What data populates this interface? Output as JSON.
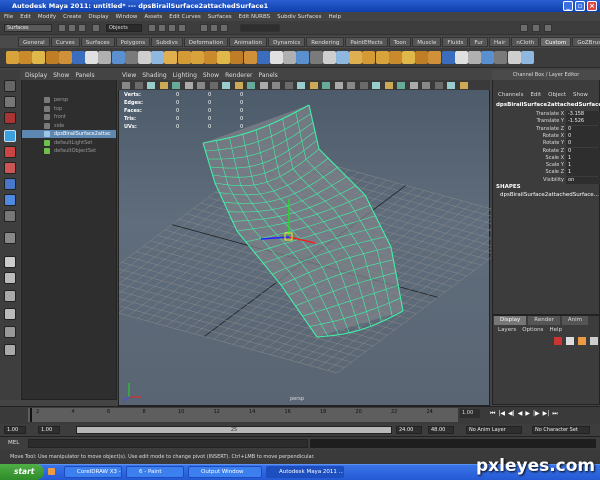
{
  "window": {
    "title": "Autodesk Maya 2011: untitled*   ---   dpsBirailSurface2attachedSurface1"
  },
  "menu": [
    "File",
    "Edit",
    "Modify",
    "Create",
    "Display",
    "Window",
    "Assets",
    "Edit Curves",
    "Surfaces",
    "Edit NURBS",
    "Subdiv Surfaces",
    "Help"
  ],
  "status": {
    "mode": "Surfaces",
    "selection_field": "Objects"
  },
  "shelf_tabs": [
    "General",
    "Curves",
    "Surfaces",
    "Polygons",
    "Subdivs",
    "Deformation",
    "Animation",
    "Dynamics",
    "Rendering",
    "PaintEffects",
    "Toon",
    "Muscle",
    "Fluids",
    "Fur",
    "Hair",
    "nCloth",
    "Custom",
    "GoZBrush"
  ],
  "active_shelf": "Custom",
  "outliner": {
    "menu": [
      "Display",
      "Show",
      "Panels"
    ],
    "items": [
      {
        "label": "persp",
        "color": "#7a7a7a"
      },
      {
        "label": "top",
        "color": "#7a7a7a"
      },
      {
        "label": "front",
        "color": "#7a7a7a"
      },
      {
        "label": "side",
        "color": "#7a7a7a"
      },
      {
        "label": "dpsBirailSurface2attac",
        "color": "#9cc8e6",
        "selected": true
      },
      {
        "label": "defaultLightSet",
        "color": "#6fbf4f"
      },
      {
        "label": "defaultObjectSet",
        "color": "#6fbf4f"
      }
    ]
  },
  "viewport": {
    "menu": [
      "View",
      "Shading",
      "Lighting",
      "Show",
      "Renderer",
      "Panels"
    ],
    "hud": [
      "Verts:",
      "Edges:",
      "Faces:",
      "Tris:",
      "UVs:"
    ],
    "hud_values": [
      "0",
      "0",
      "0",
      "0",
      "0"
    ],
    "camera_label": "persp"
  },
  "channel_box": {
    "header": "Channel Box / Layer Editor",
    "menu": [
      "Channels",
      "Edit",
      "Object",
      "Show"
    ],
    "object": "dpsBirailSurface2attachedSurface1",
    "channels": [
      {
        "name": "Translate X",
        "value": "-3.158"
      },
      {
        "name": "Translate Y",
        "value": "-1.526"
      },
      {
        "name": "Translate Z",
        "value": "0"
      },
      {
        "name": "Rotate X",
        "value": "0"
      },
      {
        "name": "Rotate Y",
        "value": "0"
      },
      {
        "name": "Rotate Z",
        "value": "0"
      },
      {
        "name": "Scale X",
        "value": "1"
      },
      {
        "name": "Scale Y",
        "value": "1"
      },
      {
        "name": "Scale Z",
        "value": "1"
      },
      {
        "name": "Visibility",
        "value": "on"
      }
    ],
    "shapes_label": "SHAPES",
    "shape_name": "dpsBirailSurface2attachedSurface..."
  },
  "layer_editor": {
    "tabs": [
      "Display",
      "Render",
      "Anim"
    ],
    "active_tab": "Display",
    "menu": [
      "Layers",
      "Options",
      "Help"
    ]
  },
  "timeline": {
    "ticks": [
      "2",
      "4",
      "6",
      "8",
      "10",
      "12",
      "14",
      "16",
      "18",
      "20",
      "22",
      "24"
    ],
    "current": "1.00",
    "range_start": "1.00",
    "range_inner_start": "1.00",
    "slider_value": "25",
    "range_inner_end": "24.00",
    "range_end": "48.00",
    "anim_layer": "No Anim Layer",
    "char_set": "No Character Set"
  },
  "mel": {
    "label": "MEL"
  },
  "help_line": "Move Tool: Use manipulator to move object(s). Use edit mode to change pivot (INSERT). Ctrl+LMB to move perpendicular.",
  "taskbar": {
    "start": "start",
    "tasks": [
      "CorelDRAW X3 - [Gra...",
      "6 - Paint",
      "Output Window",
      "Autodesk Maya 2011 ..."
    ],
    "active": 3
  },
  "watermark": "pxleyes.com",
  "colors": {
    "surface_wire": "#40f0a8",
    "grid": "#8a8a8a",
    "viewport_top": "#4a5868",
    "title_blue": "#1f4fc8"
  }
}
